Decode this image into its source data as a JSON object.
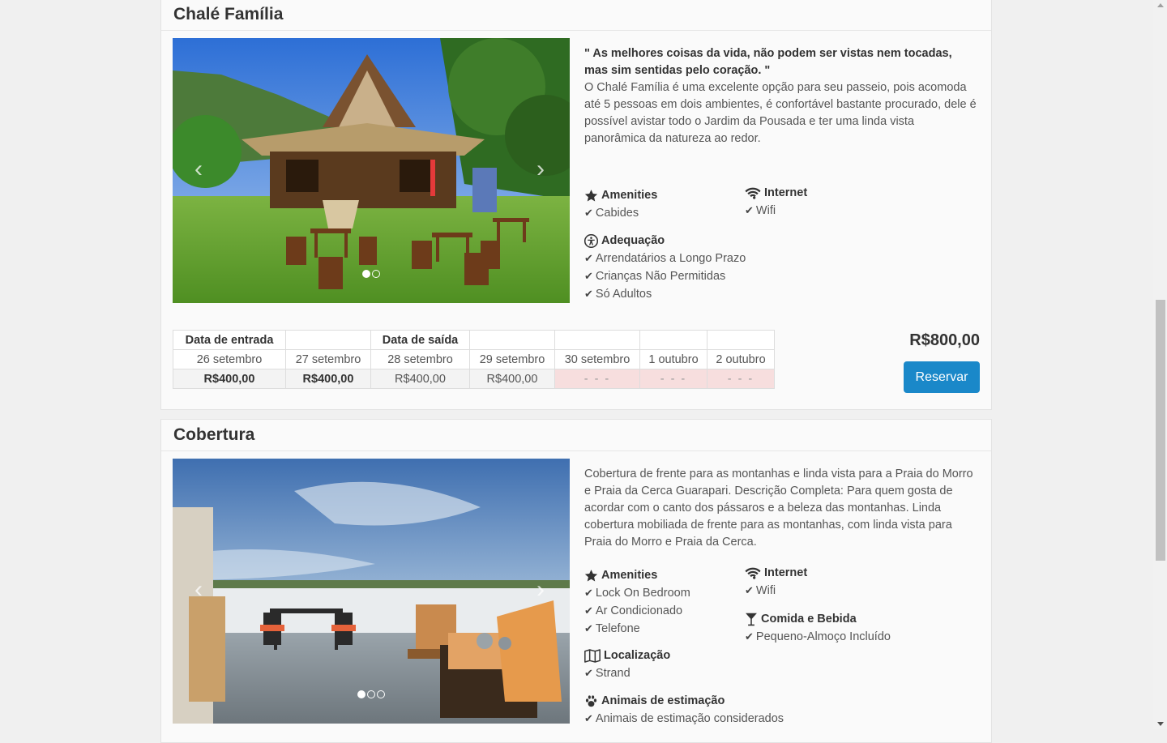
{
  "rooms": [
    {
      "title": "Chalé Família",
      "quote": "\" As melhores coisas da vida, não podem ser vistas nem tocadas, mas sim sentidas pelo coração. \"",
      "description": "O Chalé Família é uma excelente opção para seu passeio, pois acomoda até 5 pessoas em dois ambientes, é confortável bastante procurado, dele é possível avistar todo o Jardim da Pousada e ter uma linda vista panorâmica da natureza ao redor.",
      "prev_glyph": "‹",
      "next_glyph": "›",
      "features": {
        "amenities": {
          "title": "Amenities",
          "icon": "star-icon",
          "items": [
            "Cabides"
          ]
        },
        "internet": {
          "title": "Internet",
          "icon": "wifi-icon",
          "items": [
            "Wifi"
          ]
        },
        "suitability": {
          "title": "Adequação",
          "icon": "accessibility-icon",
          "items": [
            "Arrendatários a Longo Prazo",
            "Crianças Não Permitidas",
            "Só Adultos"
          ]
        }
      },
      "availability": {
        "headers": [
          "Data de entrada",
          "",
          "Data de saída",
          "",
          "",
          "",
          ""
        ],
        "dates": [
          "26 setembro",
          "27 setembro",
          "28 setembro",
          "29 setembro",
          "30 setembro",
          "1 outubro",
          "2 outubro"
        ],
        "prices": [
          "R$400,00",
          "R$400,00",
          "R$400,00",
          "R$400,00",
          "- - -",
          "- - -",
          "- - -"
        ]
      },
      "total": "R$800,00",
      "reserve_label": "Reservar"
    },
    {
      "title": "Cobertura",
      "description": "Cobertura de frente para as montanhas e linda vista para a Praia do Morro e Praia da Cerca Guarapari. Descrição Completa: Para quem gosta de acordar com o canto dos pássaros e a beleza das montanhas. Linda cobertura mobiliada de frente para as montanhas, com linda vista para Praia do Morro e Praia da Cerca.",
      "prev_glyph": "‹",
      "next_glyph": "›",
      "features": {
        "amenities": {
          "title": "Amenities",
          "icon": "star-icon",
          "items": [
            "Lock On Bedroom",
            "Ar Condicionado",
            "Telefone"
          ]
        },
        "internet": {
          "title": "Internet",
          "icon": "wifi-icon",
          "items": [
            "Wifi"
          ]
        },
        "food": {
          "title": "Comida e Bebida",
          "icon": "cocktail-icon",
          "items": [
            "Pequeno-Almoço Incluído"
          ]
        },
        "location": {
          "title": "Localização",
          "icon": "map-icon",
          "items": [
            "Strand"
          ]
        },
        "pets": {
          "title": "Animais de estimação",
          "icon": "paw-icon",
          "items": [
            "Animais de estimação considerados"
          ]
        }
      }
    }
  ],
  "colors": {
    "button": "#1a88c9",
    "unavailable": "#f7dede"
  }
}
